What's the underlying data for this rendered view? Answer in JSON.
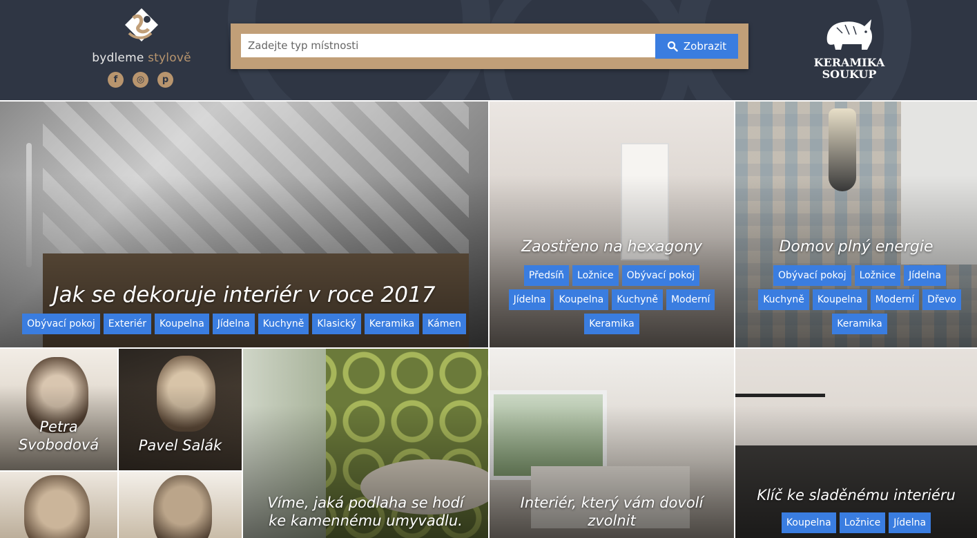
{
  "header": {
    "logo_word1": "bydleme",
    "logo_word2": "stylově",
    "socials": [
      {
        "icon": "facebook-icon",
        "glyph": "f"
      },
      {
        "icon": "instagram-icon",
        "glyph": "◎"
      },
      {
        "icon": "pinterest-icon",
        "glyph": "p"
      }
    ],
    "search": {
      "placeholder": "Zadejte typ místnosti",
      "button_label": "Zobrazit"
    },
    "brand_line1": "KERAMIKA",
    "brand_line2": "SOUKUP"
  },
  "colors": {
    "header_bg": "#2f3644",
    "accent": "#3a7de0",
    "tan": "#c19f78"
  },
  "tiles": {
    "main": {
      "title": "Jak se dekoruje interiér v roce 2017",
      "tags": [
        "Obývací pokoj",
        "Exteriér",
        "Koupelna",
        "Jídelna",
        "Kuchyně",
        "Klasický",
        "Keramika",
        "Kámen"
      ]
    },
    "hexagony": {
      "title": "Zaostřeno na hexagony",
      "tags": [
        "Předsíň",
        "Ložnice",
        "Obývací pokoj",
        "Jídelna",
        "Koupelna",
        "Kuchyně",
        "Moderní",
        "Keramika"
      ]
    },
    "energie": {
      "title": "Domov plný energie",
      "tags": [
        "Obývací pokoj",
        "Ložnice",
        "Jídelna",
        "Kuchyně",
        "Koupelna",
        "Moderní",
        "Dřevo",
        "Keramika"
      ]
    },
    "podlaha": {
      "title": "Víme, jaká podlaha se hodí ke kamennému umyvadlu."
    },
    "interier": {
      "title": "Interiér, který vám dovolí zvolnit"
    },
    "klic": {
      "title": "Klíč ke sladěnému interiéru",
      "tags": [
        "Koupelna",
        "Ložnice",
        "Jídelna"
      ]
    }
  },
  "people": [
    {
      "name": "Petra Svobodová"
    },
    {
      "name": "Pavel Salák"
    }
  ]
}
